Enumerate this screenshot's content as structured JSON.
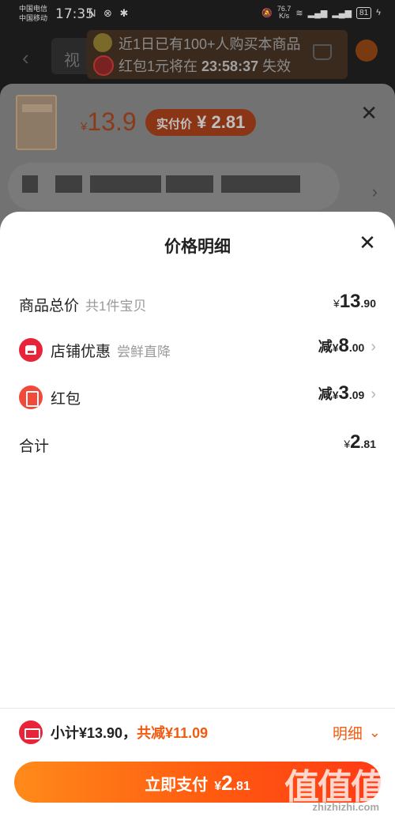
{
  "status_bar": {
    "carrier1": "中国电信",
    "carrier2": "中国移动",
    "time": "17:35",
    "icons": "N ⊗ ✱",
    "speed_value": "76.7",
    "speed_unit": "K/s",
    "battery": "81"
  },
  "background": {
    "tab_label": "视",
    "banner_line1": "近1日已有100+人购买本商品",
    "banner_line2_prefix": "红包1元将在",
    "banner_timer": "23:58:37",
    "banner_line2_suffix": "失效"
  },
  "order_sheet": {
    "currency": "¥",
    "price": "13.9",
    "actual_label": "实付价",
    "actual_price": "¥ 2.81",
    "close_glyph": "✕"
  },
  "price_detail": {
    "title": "价格明细",
    "close_glyph": "✕",
    "rows": [
      {
        "label": "商品总价",
        "sub": "共1件宝贝",
        "yen": "¥",
        "int": "13",
        "dec": ".90"
      },
      {
        "label": "店铺优惠",
        "sub": "尝鲜直降",
        "prefix": "减",
        "yen": "¥",
        "int": "8",
        "dec": ".00",
        "icon": "shop-icon"
      },
      {
        "label": "红包",
        "sub": "",
        "prefix": "减",
        "yen": "¥",
        "int": "3",
        "dec": ".09",
        "icon": "red-packet-icon"
      },
      {
        "label": "合计",
        "sub": "",
        "yen": "¥",
        "int": "2",
        "dec": ".81"
      }
    ]
  },
  "footer": {
    "subtotal": "小计¥13.90，",
    "reduced": "共减¥11.09",
    "detail_label": "明细",
    "pay_label": "立即支付",
    "pay_yen": "¥",
    "pay_int": "2",
    "pay_dec": ".81"
  },
  "watermark": {
    "glyphs": "值值值",
    "url": "zhizhizhi.com"
  },
  "colors": {
    "accent": "#f25a10",
    "badge_red": "#e8243a",
    "pay_gradient_start": "#ff8a1a",
    "pay_gradient_end": "#ff3a16"
  }
}
